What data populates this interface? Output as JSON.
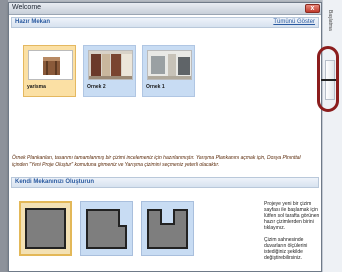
{
  "window": {
    "title": "Welcome",
    "close_glyph": "x"
  },
  "samples_section": {
    "header": "Hazır Mekan",
    "show_all_link": "Tümünü Göster",
    "items": [
      {
        "label": "yarisma",
        "selected": true
      },
      {
        "label": "Ornek 2",
        "selected": false
      },
      {
        "label": "Ornek 1",
        "selected": false
      }
    ]
  },
  "description": "Örnek Plankanları, tasarımı tamamlanmış bir çizimi incelemeniz için hazırlanmıştır. Yarışma Plankanını açmak için, Dosya Plnınttal içinden \"Yeni Proje Oluştur\" komutuna girmeniz ve Yarışma çizimini seçmeniz yeterli olacaktır.",
  "plans_section": {
    "header": "Kendi Mekanınızı Oluşturun",
    "items": [
      {
        "name": "square-room",
        "selected": true
      },
      {
        "name": "l-shape-room",
        "selected": false
      },
      {
        "name": "u-shape-room",
        "selected": false
      }
    ]
  },
  "help": {
    "paragraph1": "Projeye yeni bir çizim sayfası ile başlamak için lütfen sol tarafta görünen hazır çizimlerden birini tıklayınız.",
    "paragraph2": "Çizim sahnesinde duvarların ölçülerini istediğiniz şekilde değiştirebilirsiniz."
  },
  "side_panel": {
    "tab_label": "Başlatma"
  }
}
